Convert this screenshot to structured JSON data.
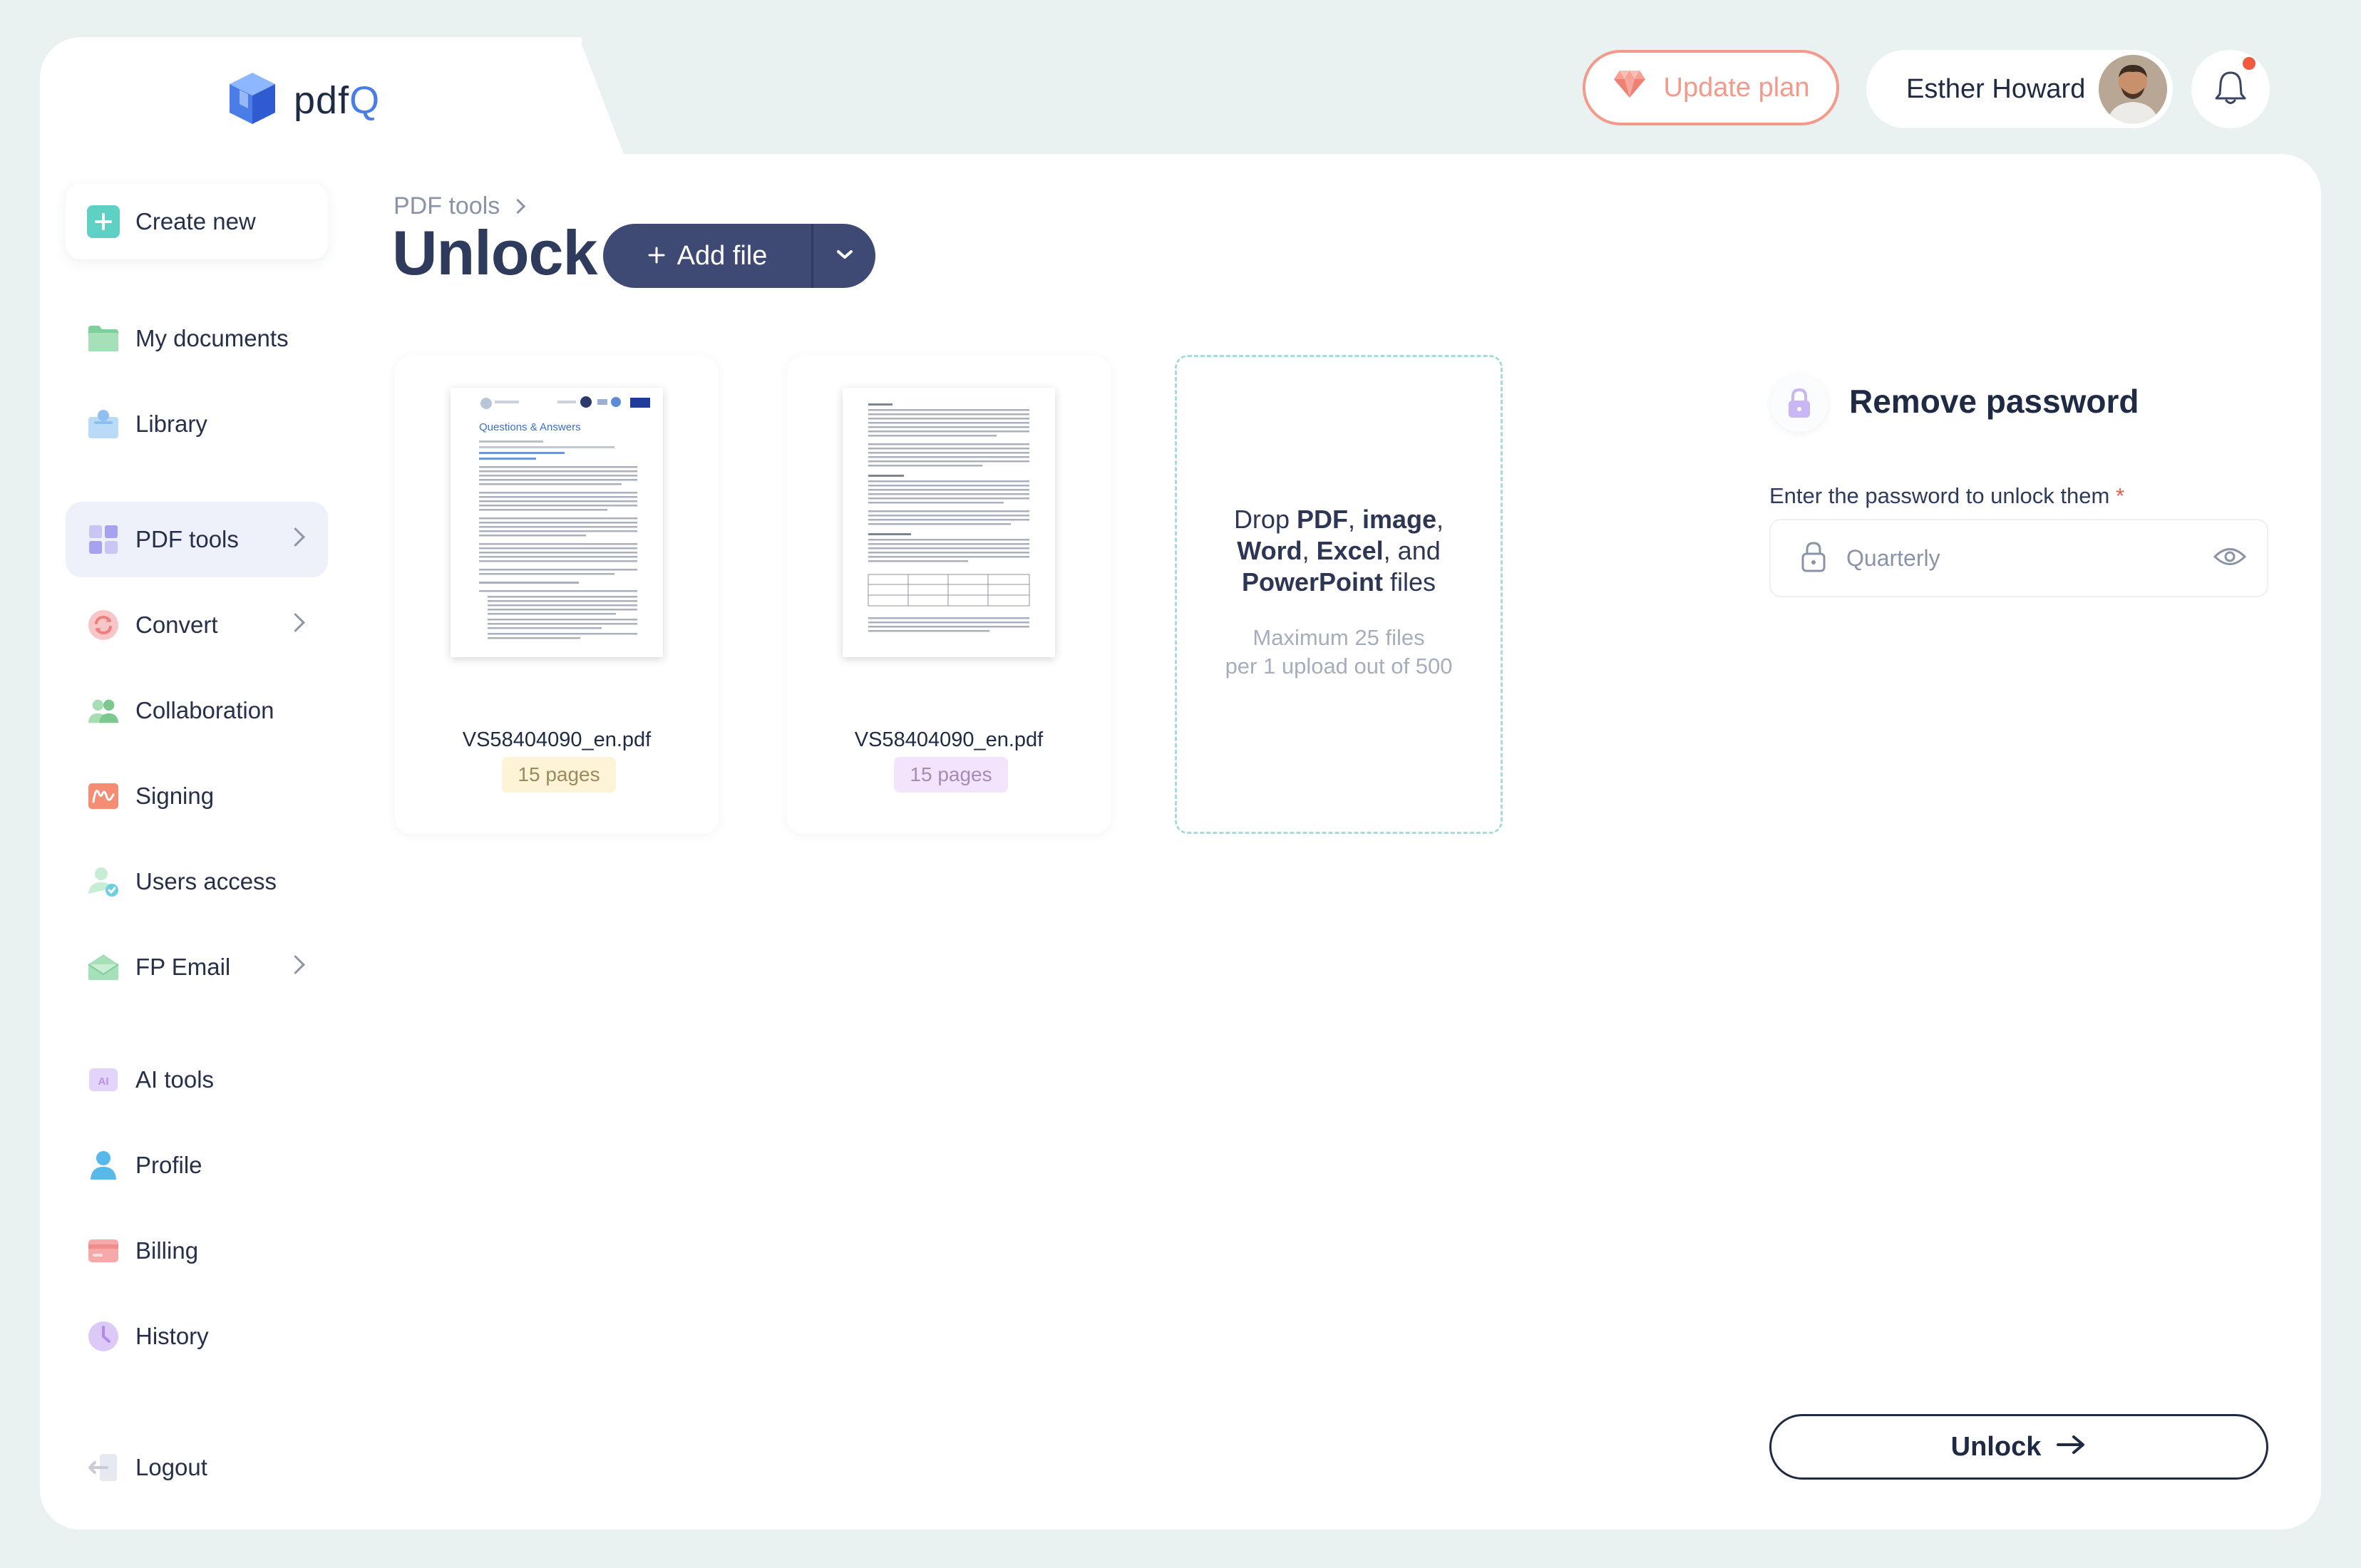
{
  "app": {
    "logo_main": "pdf",
    "logo_accent": "Q"
  },
  "header": {
    "update_plan": "Update plan",
    "user_name": "Esther Howard"
  },
  "sidebar": {
    "create_new": "Create new",
    "items": [
      {
        "label": "My documents"
      },
      {
        "label": "Library"
      },
      {
        "label": "PDF tools"
      },
      {
        "label": "Convert"
      },
      {
        "label": "Collaboration"
      },
      {
        "label": "Signing"
      },
      {
        "label": "Users access"
      },
      {
        "label": "FP Email"
      },
      {
        "label": "AI tools"
      },
      {
        "label": "Profile"
      },
      {
        "label": "Billing"
      },
      {
        "label": "History"
      },
      {
        "label": "Logout"
      }
    ]
  },
  "breadcrumb": {
    "parent": "PDF tools"
  },
  "page": {
    "title": "Unlock",
    "add_file": "Add file"
  },
  "files": [
    {
      "name": "VS58404090_en.pdf",
      "pages": "15 pages"
    },
    {
      "name": "VS58404090_en.pdf",
      "pages": "15 pages"
    }
  ],
  "thumb1": {
    "heading": "Questions & Answers"
  },
  "dropzone": {
    "t1": "Drop ",
    "b1": "PDF",
    "t2": ", ",
    "b2": "image",
    "t3": ", ",
    "b3": "Word",
    "t4": ", ",
    "b4": "Excel",
    "t5": ", and ",
    "b5": "PowerPoint",
    "t6": " files",
    "sub1": "Maximum 25 files",
    "sub2": "per 1 upload out of 500"
  },
  "panel": {
    "title": "Remove password",
    "field_label": "Enter the password to unlock them",
    "required_mark": "*",
    "password_value": "Quarterly",
    "unlock_button": "Unlock"
  },
  "colors": {
    "accent": "#3e4a73",
    "update_plan": "#f39a8b",
    "badge_yellow": "#fdf3d6",
    "badge_purple": "#f3e4fb",
    "dropzone_border": "#a9dcd4"
  }
}
